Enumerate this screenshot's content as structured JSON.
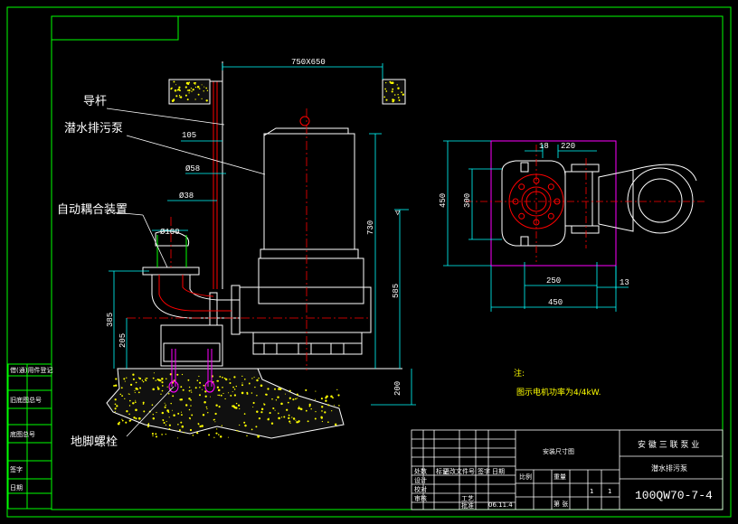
{
  "colors": {
    "background": "#000000",
    "frame": "#00ff00",
    "dimension": "#00ffff",
    "centerline": "#ff0000",
    "pump": "#ffffff",
    "text": "#ffffff",
    "note": "#ffff00",
    "flange": "#ff0000",
    "plate": "#ff00ff",
    "concrete_dots": "#ffff00"
  },
  "labels": {
    "guide_rail": "导杆",
    "pump": "潜水排污泵",
    "coupling": "自动耦合装置",
    "anchor_bolt": "地脚螺栓"
  },
  "dimensions": {
    "top_width": "750X650",
    "d105": "105",
    "d58": "Ø58",
    "d238": "Ø38",
    "d100": "Ø100",
    "h730": "730",
    "h585": "585",
    "h385": "385",
    "h205": "205",
    "h200": "200",
    "p18": "18",
    "p220": "220",
    "p450v": "450",
    "p300": "300",
    "p250": "250",
    "p13": "13",
    "p450h": "450",
    "level_mark": "▽"
  },
  "notes": {
    "title": "注:",
    "line1": "图示电机功率为4/4kW."
  },
  "title_block": {
    "drawing_name": "安装尺寸图",
    "company": "安 徽 三 联 泵 业",
    "product": "潜水排污泵",
    "model": "100QW70-7-4",
    "date": "06.11.4",
    "scale_label": "比例",
    "sheet_label": "第 张",
    "weight_label": "重量",
    "row_labels": [
      "标记",
      "处数",
      "更改文件号",
      "签字",
      "日期"
    ],
    "role_labels": [
      "设计",
      "校对",
      "审核",
      "工艺",
      "批准"
    ],
    "side_labels": [
      "借(通)用件登记",
      "旧底图总号",
      "底图总号",
      "签字",
      "日期"
    ],
    "values": [
      "1",
      "1"
    ]
  }
}
